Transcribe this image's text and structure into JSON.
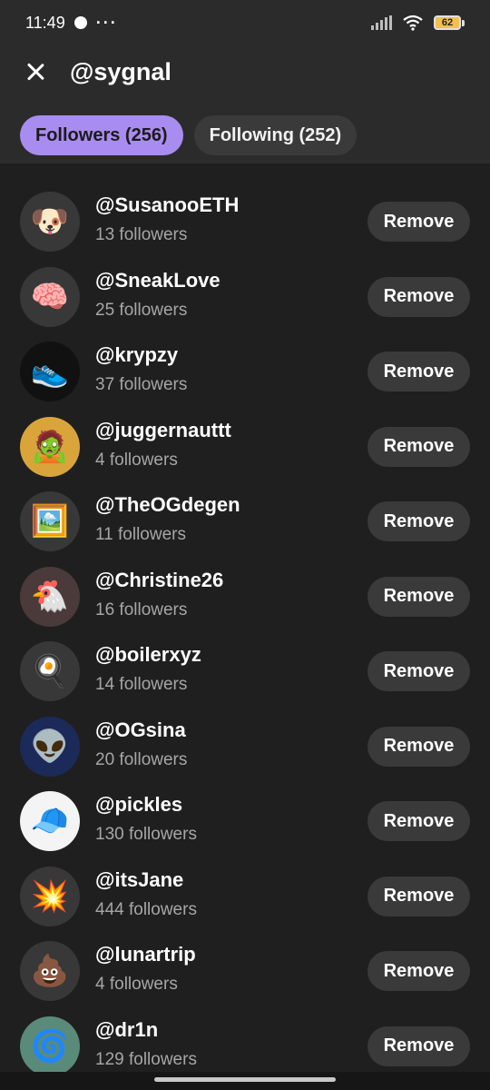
{
  "status_bar": {
    "time": "11:49",
    "dots": "···",
    "battery": "62"
  },
  "header": {
    "title": "@sygnal",
    "tabs": [
      {
        "label": "Followers (256)",
        "active": true
      },
      {
        "label": "Following (252)",
        "active": false
      }
    ]
  },
  "remove_label": "Remove",
  "followers": [
    {
      "handle": "@SusanooETH",
      "followers": "13 followers",
      "avatar": "🐶",
      "avatar_bg": "#383838"
    },
    {
      "handle": "@SneakLove",
      "followers": "25 followers",
      "avatar": "🧠",
      "avatar_bg": "#383838"
    },
    {
      "handle": "@krypzy",
      "followers": "37 followers",
      "avatar": "👟",
      "avatar_bg": "#111111"
    },
    {
      "handle": "@juggernauttt",
      "followers": "4 followers",
      "avatar": "🧟",
      "avatar_bg": "#d9a53b"
    },
    {
      "handle": "@TheOGdegen",
      "followers": "11 followers",
      "avatar": "🖼️",
      "avatar_bg": "#383838"
    },
    {
      "handle": "@Christine26",
      "followers": "16 followers",
      "avatar": "🐔",
      "avatar_bg": "#4a3a3a"
    },
    {
      "handle": "@boilerxyz",
      "followers": "14 followers",
      "avatar": "🍳",
      "avatar_bg": "#383838"
    },
    {
      "handle": "@OGsina",
      "followers": "20 followers",
      "avatar": "👽",
      "avatar_bg": "#1c2a5a"
    },
    {
      "handle": "@pickles",
      "followers": "130 followers",
      "avatar": "🧢",
      "avatar_bg": "#f4f4f4"
    },
    {
      "handle": "@itsJane",
      "followers": "444 followers",
      "avatar": "💥",
      "avatar_bg": "#383838"
    },
    {
      "handle": "@lunartrip",
      "followers": "4 followers",
      "avatar": "💩",
      "avatar_bg": "#383838"
    },
    {
      "handle": "@dr1n",
      "followers": "129 followers",
      "avatar": "🌀",
      "avatar_bg": "#5a8a7a"
    }
  ]
}
